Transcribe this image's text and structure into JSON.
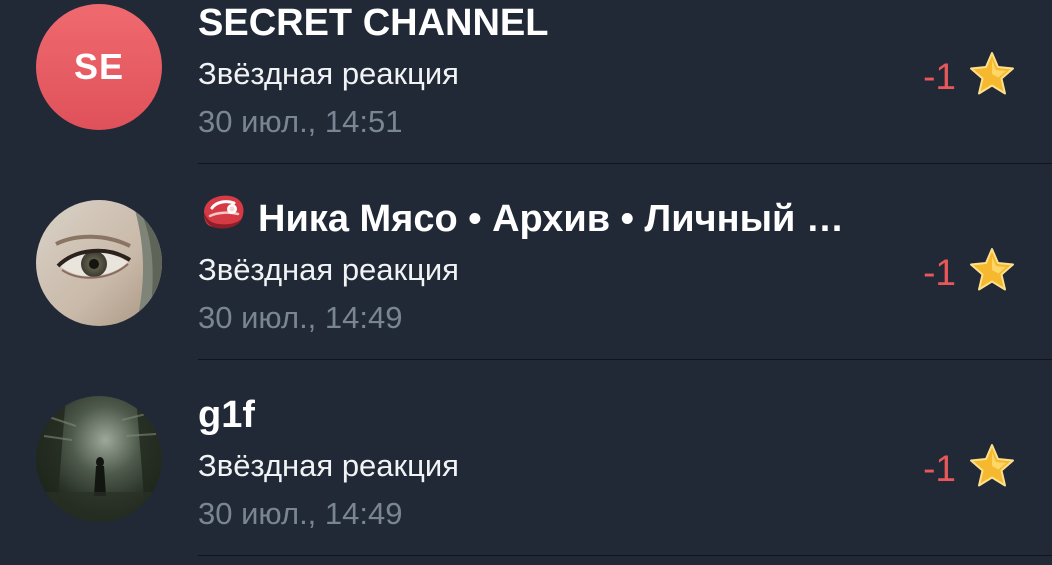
{
  "transactions": [
    {
      "avatar": {
        "type": "initials",
        "text": "SE",
        "color": "#e8575a"
      },
      "title": "SECRET CHANNEL",
      "title_emoji": "",
      "subtitle": "Звёздная реакция",
      "date": "30 июл., 14:51",
      "amount": "-1",
      "amount_icon": "star-icon"
    },
    {
      "avatar": {
        "type": "photo",
        "description": "eye-photo"
      },
      "title": "Ника Мясо • Архив • Личный …",
      "title_emoji": "meat-emoji",
      "subtitle": "Звёздная реакция",
      "date": "30 июл., 14:49",
      "amount": "-1",
      "amount_icon": "star-icon"
    },
    {
      "avatar": {
        "type": "photo",
        "description": "dark-figure-photo"
      },
      "title": "g1f",
      "title_emoji": "",
      "subtitle": "Звёздная реакция",
      "date": "30 июл., 14:49",
      "amount": "-1",
      "amount_icon": "star-icon"
    }
  ],
  "colors": {
    "background": "#212936",
    "negative_amount": "#e8575a",
    "date_text": "#7a8593",
    "star": "#f5b82e"
  }
}
